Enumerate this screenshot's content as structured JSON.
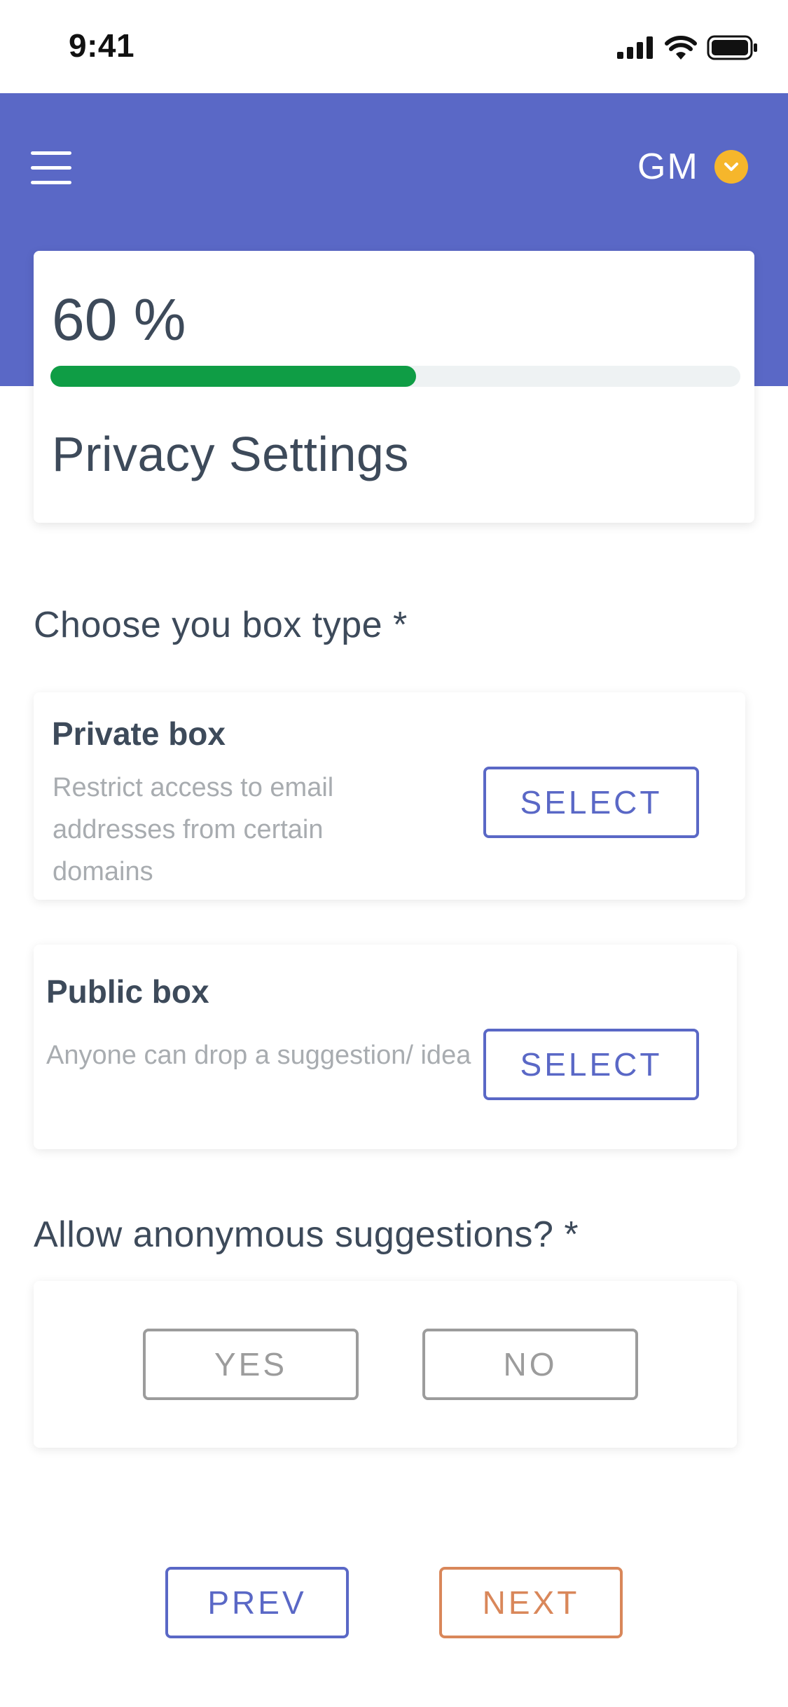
{
  "status_bar": {
    "time": "9:41",
    "icons": [
      "signal-icon",
      "wifi-icon",
      "battery-icon"
    ]
  },
  "header": {
    "menu_icon": "hamburger-menu-icon",
    "user_initials": "GM",
    "user_menu_icon": "chevron-down-icon"
  },
  "progress": {
    "percent_label": "60 %",
    "value": 0.53,
    "title": "Privacy Settings"
  },
  "box_type": {
    "label": "Choose you box type *",
    "options": [
      {
        "title": "Private box",
        "description": "Restrict access to email addresses from certain domains",
        "button": "SELECT"
      },
      {
        "title": "Public box",
        "description": "Anyone can drop a suggestion/ idea",
        "button": "SELECT"
      }
    ]
  },
  "anonymous": {
    "label": "Allow anonymous suggestions? *",
    "yes": "YES",
    "no": "NO"
  },
  "nav": {
    "prev": "PREV",
    "next": "NEXT"
  },
  "colors": {
    "header_bg": "#5a68c6",
    "progress_fill": "#0f9d45",
    "accent_orange": "#d9875a",
    "chevron_badge": "#f6b62b"
  }
}
